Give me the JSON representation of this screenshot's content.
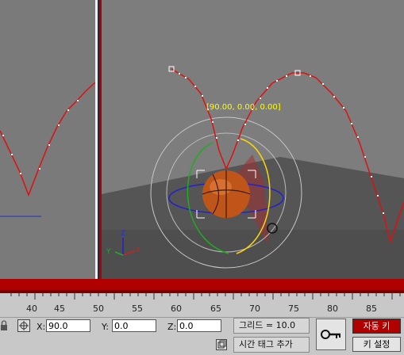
{
  "viewport": {
    "transform_readout": "[90.00, 0.00, 0.00]",
    "axis_labels": {
      "x": "X",
      "y": "Y",
      "z": "Z"
    }
  },
  "timeline": {
    "ticks": [
      "40",
      "45",
      "50",
      "55",
      "60",
      "65",
      "70",
      "75",
      "80",
      "85"
    ]
  },
  "coords": {
    "x_label": "X:",
    "x_value": "90.0",
    "y_label": "Y:",
    "y_value": "0.0",
    "z_label": "Z:",
    "z_value": "0.0"
  },
  "grid": {
    "label": "그리드 = 10.0"
  },
  "time_tag": {
    "label": "시간 태그 추가"
  },
  "keys": {
    "auto_key": "자동 키",
    "set_key": "키 설정"
  },
  "colors": {
    "timeslider": "#b00000",
    "trajectory": "#dd1111",
    "readout": "#ffff00",
    "ball": "#c0551a"
  },
  "icons": {
    "lock": "lock-icon",
    "absolute_mode": "absolute-mode-icon",
    "key": "key-icon",
    "time_tag_toggle": "time-tag-toggle-icon"
  }
}
